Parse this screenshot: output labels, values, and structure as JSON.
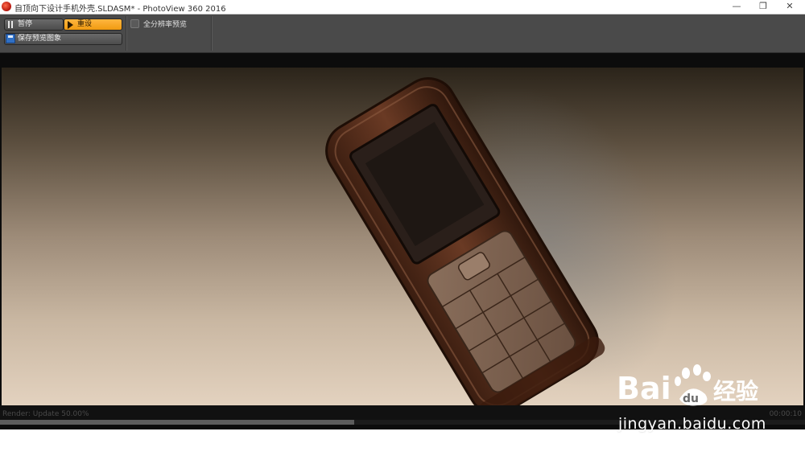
{
  "window": {
    "title": "自顶向下设计手机外壳.SLDASM* - PhotoView 360 2016",
    "minimize_glyph": "—",
    "restore_glyph": "❐",
    "close_glyph": "✕"
  },
  "toolbar": {
    "pause_label": "暂停",
    "reset_label": "重设",
    "save_label": "保存预览图象",
    "fullres_label": "全分辨率预览",
    "fullres_checked": false,
    "accent_color": "#f5a623"
  },
  "status": {
    "render_text": "Render: Update 50.00%",
    "elapsed": "00:00:10",
    "progress_fraction": 0.44
  },
  "watermark": {
    "logo_text_latin": "Bai",
    "logo_text_du": "du",
    "logo_text_cn": "经验",
    "url": "jingyan.baidu.com"
  },
  "icons": {
    "app": "photoview-app-icon",
    "pause": "pause-icon",
    "reset": "play-icon",
    "save": "floppy-disk-icon"
  }
}
